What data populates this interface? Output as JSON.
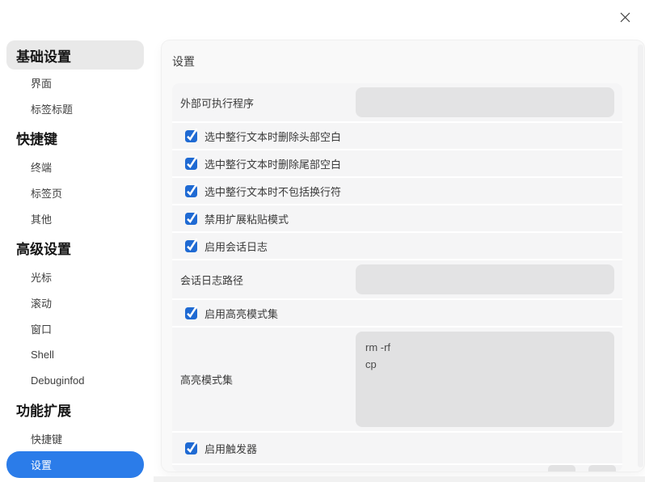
{
  "window": {
    "close_icon": "x-cross"
  },
  "colors": {
    "sidebar_selected_blue": "#2b7ce9",
    "checkbox_blue": "#1f6ad3",
    "panel_bg": "#f9f9f9",
    "row_bg": "#f5f5f6",
    "field_bg": "#e3e3e4"
  },
  "sidebar": {
    "entries": [
      {
        "label": "基础设置",
        "type": "header",
        "active": true
      },
      {
        "label": "界面",
        "type": "item"
      },
      {
        "label": "标签标题",
        "type": "item"
      },
      {
        "label": "快捷键",
        "type": "header"
      },
      {
        "label": "终端",
        "type": "item"
      },
      {
        "label": "标签页",
        "type": "item"
      },
      {
        "label": "其他",
        "type": "item"
      },
      {
        "label": "高级设置",
        "type": "header"
      },
      {
        "label": "光标",
        "type": "item"
      },
      {
        "label": "滚动",
        "type": "item"
      },
      {
        "label": "窗口",
        "type": "item"
      },
      {
        "label": "Shell",
        "type": "item"
      },
      {
        "label": "Debuginfod",
        "type": "item"
      },
      {
        "label": "功能扩展",
        "type": "header"
      },
      {
        "label": "快捷键",
        "type": "item"
      },
      {
        "label": "设置",
        "type": "item",
        "selected": true
      }
    ]
  },
  "main": {
    "title": "设置",
    "rows": [
      {
        "type": "input",
        "label": "外部可执行程序",
        "value": ""
      },
      {
        "type": "checkbox",
        "label": "选中整行文本时删除头部空白",
        "checked": true
      },
      {
        "type": "checkbox",
        "label": "选中整行文本时删除尾部空白",
        "checked": true
      },
      {
        "type": "checkbox",
        "label": "选中整行文本时不包括换行符",
        "checked": true
      },
      {
        "type": "checkbox",
        "label": "禁用扩展粘贴模式",
        "checked": true
      },
      {
        "type": "checkbox",
        "label": "启用会话日志",
        "checked": true
      },
      {
        "type": "input",
        "label": "会话日志路径",
        "value": ""
      },
      {
        "type": "checkbox",
        "label": "启用高亮模式集",
        "checked": true
      },
      {
        "type": "textarea",
        "label": "高亮模式集",
        "value": "rm -rf\ncp"
      },
      {
        "type": "checkbox",
        "label": "启用触发器",
        "checked": true
      }
    ]
  }
}
